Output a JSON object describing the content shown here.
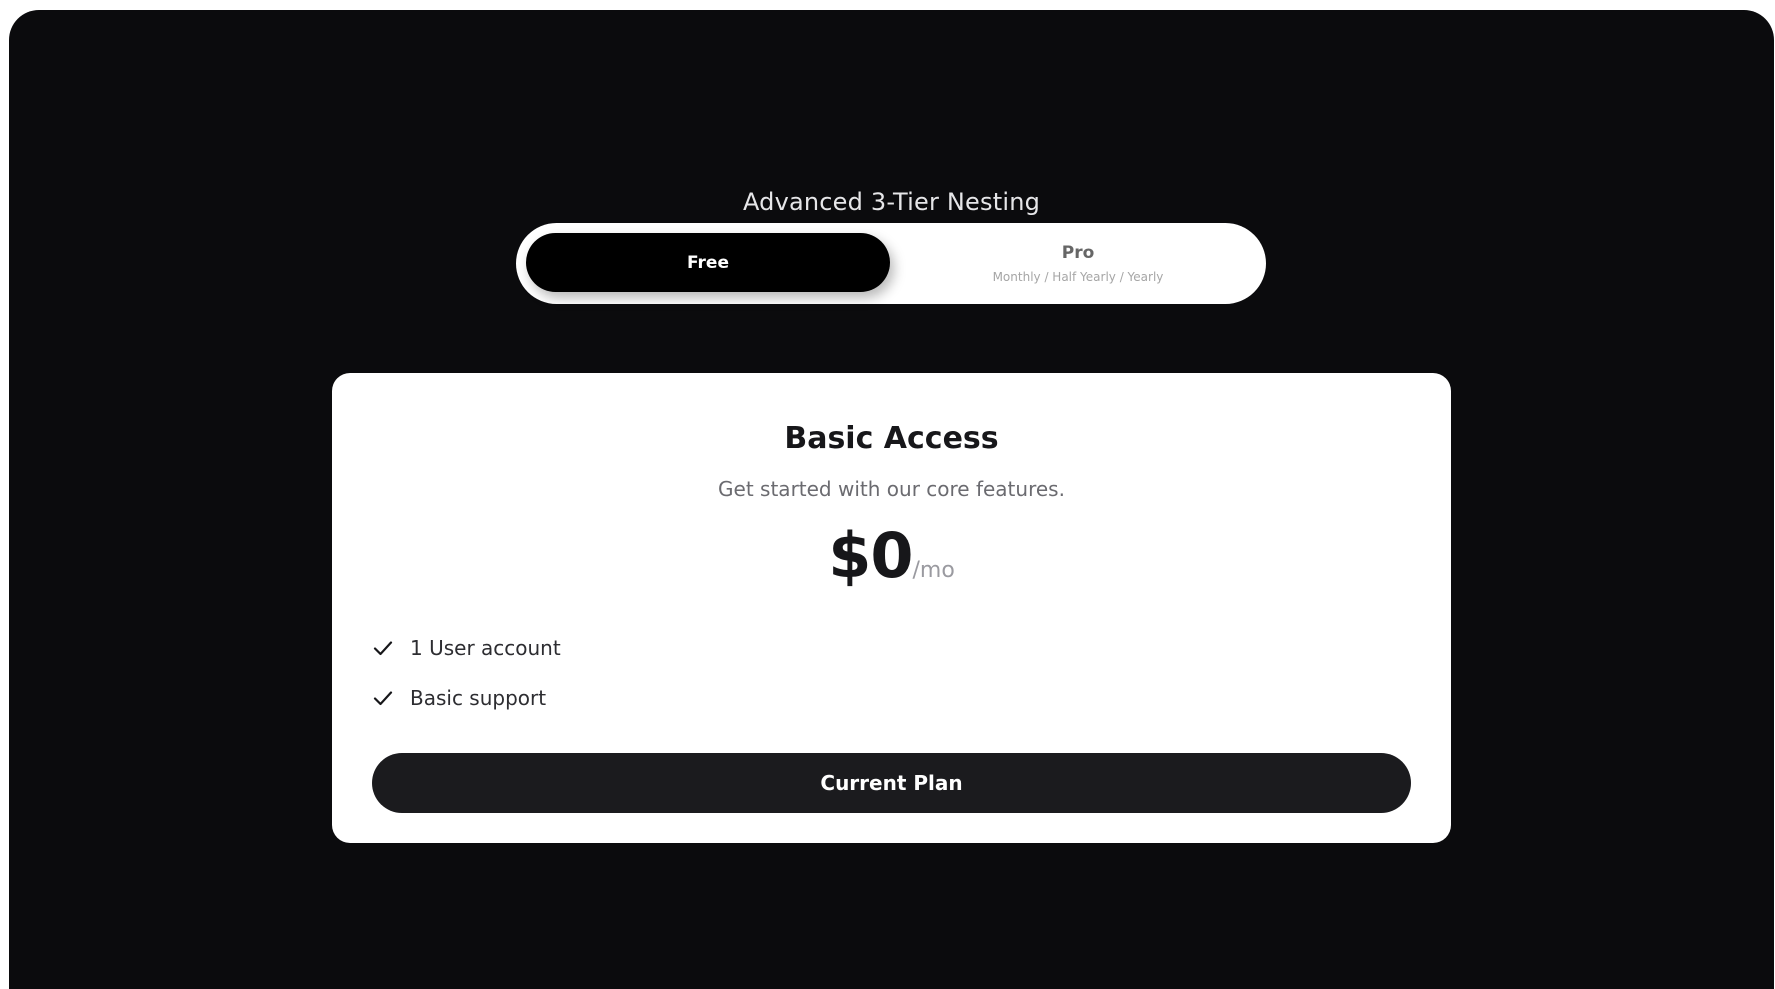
{
  "heading": "Advanced 3-Tier Nesting",
  "toggle": {
    "free_label": "Free",
    "pro_label": "Pro",
    "pro_sublabel": "Monthly / Half Yearly / Yearly",
    "selected": "Free"
  },
  "card": {
    "title": "Basic Access",
    "description": "Get started with our core features.",
    "price": "$0",
    "period": "/mo",
    "features": [
      {
        "icon": "check-icon",
        "label": "1 User account"
      },
      {
        "icon": "check-icon",
        "label": "Basic support"
      }
    ],
    "cta_label": "Current Plan"
  },
  "colors": {
    "background": "#0b0b0d",
    "card": "#ffffff",
    "toggle_active": "#000000",
    "cta": "#1b1b1e"
  }
}
